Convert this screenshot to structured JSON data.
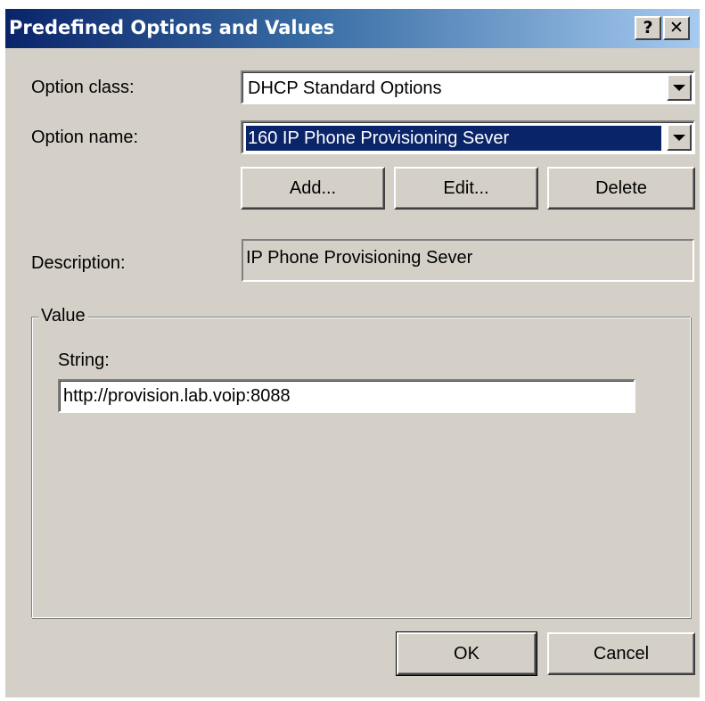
{
  "window": {
    "title": "Predefined Options and Values",
    "help_glyph": "?",
    "close_glyph": "✕"
  },
  "option_class": {
    "label": "Option class:",
    "value": "DHCP Standard Options"
  },
  "option_name": {
    "label": "Option name:",
    "value": "160 IP Phone Provisioning Sever"
  },
  "option_buttons": {
    "add": "Add...",
    "edit": "Edit...",
    "delete": "Delete"
  },
  "description": {
    "label": "Description:",
    "value": "IP Phone Provisioning Sever"
  },
  "value_group": {
    "legend": "Value",
    "string_label": "String:",
    "string_value": "http://provision.lab.voip:8088"
  },
  "footer": {
    "ok": "OK",
    "cancel": "Cancel"
  },
  "colors": {
    "titlebar_start": "#0a246a",
    "titlebar_end": "#a6caf0",
    "dialog_bg": "#d4d0c8",
    "selection_bg": "#0a246a"
  },
  "icons": {
    "help": "help-icon",
    "close": "close-icon",
    "dropdown": "chevron-down-icon"
  }
}
